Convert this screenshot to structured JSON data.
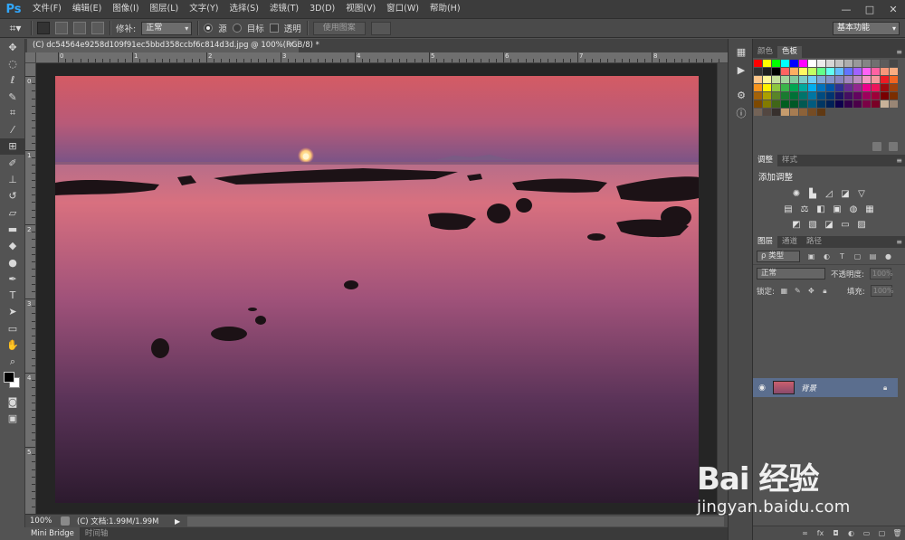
{
  "app": {
    "logo": "Ps"
  },
  "menu": [
    "文件(F)",
    "编辑(E)",
    "图像(I)",
    "图层(L)",
    "文字(Y)",
    "选择(S)",
    "滤镜(T)",
    "3D(D)",
    "视图(V)",
    "窗口(W)",
    "帮助(H)"
  ],
  "window_controls": {
    "minimize": "—",
    "maximize": "□",
    "close": "✕"
  },
  "options": {
    "patch_label": "修补:",
    "patch_mode": "正常",
    "source_label": "源",
    "target_label": "目标",
    "transparent_label": "透明",
    "use_pattern_label": "使用图案",
    "workspace": "基本功能"
  },
  "document": {
    "tab_title": "(C) dc54564e9258d109f91ec5bbd358ccbf6c814d3d.jpg @ 100%(RGB/8) *",
    "close": "×"
  },
  "rulers": {
    "h_labels": [
      "0",
      "1",
      "2",
      "3",
      "4",
      "5",
      "6",
      "7",
      "8"
    ],
    "v_labels": [
      "0",
      "1",
      "2",
      "3",
      "4",
      "5"
    ]
  },
  "status": {
    "zoom": "100%",
    "doc_info": "(C) 文档:1.99M/1.99M"
  },
  "bottom_tabs": [
    "Mini Bridge",
    "时间轴"
  ],
  "swatches_panel": {
    "tabs": [
      "颜色",
      "色板"
    ]
  },
  "adjustments_panel": {
    "tabs": [
      "调整",
      "样式"
    ],
    "title": "添加调整"
  },
  "layers_panel": {
    "tabs": [
      "图层",
      "通道",
      "路径"
    ],
    "filter_kind": "ρ 类型",
    "blend_mode": "正常",
    "opacity_label": "不透明度:",
    "opacity_value": "100%",
    "lock_label": "锁定:",
    "fill_label": "填充:",
    "fill_value": "100%",
    "layer_name": "背景"
  },
  "watermark": {
    "main": "Bai  经验",
    "url": "jingyan.baidu.com"
  },
  "colors": {
    "swatch_grid": [
      "#ff0000",
      "#ffff00",
      "#00ff00",
      "#00ffff",
      "#0000ff",
      "#ff00ff",
      "#ffffff",
      "#ebebeb",
      "#d6d6d6",
      "#c2c2c2",
      "#adadad",
      "#999999",
      "#858585",
      "#707070",
      "#5c5c5c",
      "#474747",
      "#333333",
      "#1f1f1f",
      "#000000",
      "#ff6262",
      "#ffae62",
      "#fffa62",
      "#c3ff62",
      "#62ff8a",
      "#62fff0",
      "#62bdff",
      "#6274ff",
      "#a062ff",
      "#ff62f6",
      "#ff62a3",
      "#f7977a",
      "#f9ad81",
      "#fdc68a",
      "#fff79a",
      "#c4df9b",
      "#a2d39c",
      "#82ca9d",
      "#7bcdc8",
      "#6ecff6",
      "#7ea7d8",
      "#8493ca",
      "#8882be",
      "#a187be",
      "#bc8dbf",
      "#f49ac2",
      "#f6989d",
      "#ed1c24",
      "#f26522",
      "#f7941d",
      "#fff200",
      "#8dc73f",
      "#39b54a",
      "#00a651",
      "#00a99d",
      "#00aeef",
      "#0072bc",
      "#0054a6",
      "#2e3192",
      "#662d91",
      "#92278f",
      "#ec008c",
      "#ed145b",
      "#9e0b0f",
      "#a0410d",
      "#a36209",
      "#aba000",
      "#598527",
      "#1a7b30",
      "#007236",
      "#00746b",
      "#0076a3",
      "#004b80",
      "#003471",
      "#1b1464",
      "#440e62",
      "#630460",
      "#9e005d",
      "#9e0039",
      "#790000",
      "#7b2e00",
      "#7d4900",
      "#827b00",
      "#406618",
      "#005e20",
      "#005826",
      "#005952",
      "#005b7f",
      "#003663",
      "#002157",
      "#0d004c",
      "#32004b",
      "#4b0049",
      "#7b0046",
      "#7a0026",
      "#c7b299",
      "#998675",
      "#736357",
      "#534741",
      "#37302d",
      "#c69c6d",
      "#a67c52",
      "#8c6239",
      "#754c24",
      "#603913"
    ]
  }
}
